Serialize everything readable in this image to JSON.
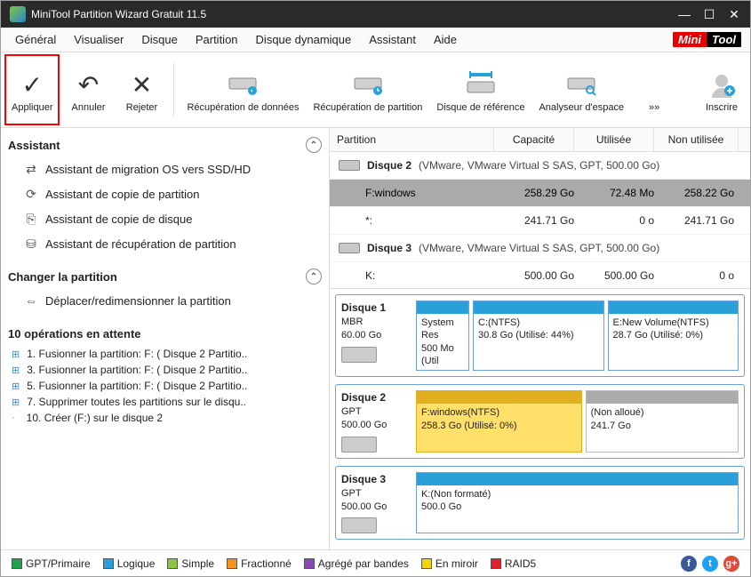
{
  "colors": {
    "gpt_primary": "#1fa24a",
    "logical": "#29a0d8",
    "simple": "#8bc53f",
    "striped": "#f7941d",
    "spanned": "#8948b3",
    "mirror": "#f2d600",
    "raid5": "#e6202a"
  },
  "titlebar": {
    "title": "MiniTool Partition Wizard Gratuit 11.5"
  },
  "menu": {
    "items": [
      "Général",
      "Visualiser",
      "Disque",
      "Partition",
      "Disque dynamique",
      "Assistant",
      "Aide"
    ],
    "logo_left": "Mini",
    "logo_right": "Tool"
  },
  "toolbar": {
    "apply": "Appliquer",
    "undo": "Annuler",
    "discard": "Rejeter",
    "data_recovery": "Récupération de données",
    "partition_recovery": "Récupération de partition",
    "benchmark": "Disque de référence",
    "space_analyzer": "Analyseur d'espace",
    "more": "»»",
    "signup": "Inscrire"
  },
  "sidebar": {
    "assistant_header": "Assistant",
    "assistant_items": [
      "Assistant de migration OS vers SSD/HD",
      "Assistant de copie de partition",
      "Assistant de copie de disque",
      "Assistant de récupération de partition"
    ],
    "change_header": "Changer la partition",
    "change_items": [
      "Déplacer/redimensionner la partition"
    ],
    "pending_header": "10 opérations en attente",
    "pending_items": [
      "1. Fusionner la partition: F: ( Disque 2 Partitio..",
      "3. Fusionner la partition: F: ( Disque 2 Partitio..",
      "5. Fusionner la partition: F: ( Disque 2 Partitio..",
      "7. Supprimer toutes les partitions sur le disqu..",
      "10. Créer (F:) sur le disque 2"
    ]
  },
  "grid": {
    "headers": [
      "Partition",
      "Capacité",
      "Utilisée",
      "Non utilisée"
    ],
    "groups": [
      {
        "name": "Disque 2",
        "info": "(VMware, VMware Virtual S SAS, GPT, 500.00 Go)",
        "rows": [
          {
            "p": "F:windows",
            "cap": "258.29 Go",
            "used": "72.48 Mo",
            "free": "258.22 Go",
            "selected": true
          },
          {
            "p": "*:",
            "cap": "241.71 Go",
            "used": "0 o",
            "free": "241.71 Go",
            "selected": false
          }
        ]
      },
      {
        "name": "Disque 3",
        "info": "(VMware, VMware Virtual S SAS, GPT, 500.00 Go)",
        "rows": [
          {
            "p": "K:",
            "cap": "500.00 Go",
            "used": "500.00 Go",
            "free": "0 o",
            "selected": false
          }
        ]
      }
    ]
  },
  "graph": [
    {
      "name": "Disque 1",
      "scheme": "MBR",
      "size": "60.00 Go",
      "segs": [
        {
          "label": "System Res",
          "detail": "500 Mo (Util",
          "flex": 1,
          "kind": "n"
        },
        {
          "label": "C:(NTFS)",
          "detail": "30.8 Go (Utilisé: 44%)",
          "flex": 3,
          "kind": "n"
        },
        {
          "label": "E:New Volume(NTFS)",
          "detail": "28.7 Go (Utilisé: 0%)",
          "flex": 3,
          "kind": "n"
        }
      ]
    },
    {
      "name": "Disque 2",
      "scheme": "GPT",
      "size": "500.00 Go",
      "segs": [
        {
          "label": "F:windows(NTFS)",
          "detail": "258.3 Go (Utilisé: 0%)",
          "flex": 52,
          "kind": "sel"
        },
        {
          "label": "(Non alloué)",
          "detail": "241.7 Go",
          "flex": 48,
          "kind": "unalloc"
        }
      ]
    },
    {
      "name": "Disque 3",
      "scheme": "GPT",
      "size": "500.00 Go",
      "segs": [
        {
          "label": "K:(Non formaté)",
          "detail": "500.0 Go",
          "flex": 1,
          "kind": "n"
        }
      ]
    }
  ],
  "legend": {
    "items": [
      {
        "label": "GPT/Primaire",
        "colorKey": "gpt_primary"
      },
      {
        "label": "Logique",
        "colorKey": "logical"
      },
      {
        "label": "Simple",
        "colorKey": "simple"
      },
      {
        "label": "Fractionné",
        "colorKey": "striped"
      },
      {
        "label": "Agrégé par bandes",
        "colorKey": "spanned"
      },
      {
        "label": "En miroir",
        "colorKey": "mirror"
      },
      {
        "label": "RAID5",
        "colorKey": "raid5"
      }
    ]
  },
  "chart_data": [
    {
      "type": "bar",
      "title": "Disque 1 (MBR, 60.00 Go)",
      "categories": [
        "System Res",
        "C:(NTFS)",
        "E:New Volume(NTFS)"
      ],
      "series": [
        {
          "name": "Capacité (Go)",
          "values": [
            0.5,
            30.8,
            28.7
          ]
        },
        {
          "name": "Utilisé (%)",
          "values": [
            null,
            44,
            0
          ]
        }
      ]
    },
    {
      "type": "bar",
      "title": "Disque 2 (GPT, 500.00 Go)",
      "categories": [
        "F:windows(NTFS)",
        "(Non alloué)"
      ],
      "series": [
        {
          "name": "Capacité (Go)",
          "values": [
            258.3,
            241.7
          ]
        },
        {
          "name": "Utilisé (%)",
          "values": [
            0,
            null
          ]
        }
      ]
    },
    {
      "type": "bar",
      "title": "Disque 3 (GPT, 500.00 Go)",
      "categories": [
        "K:(Non formaté)"
      ],
      "series": [
        {
          "name": "Capacité (Go)",
          "values": [
            500.0
          ]
        }
      ]
    }
  ]
}
